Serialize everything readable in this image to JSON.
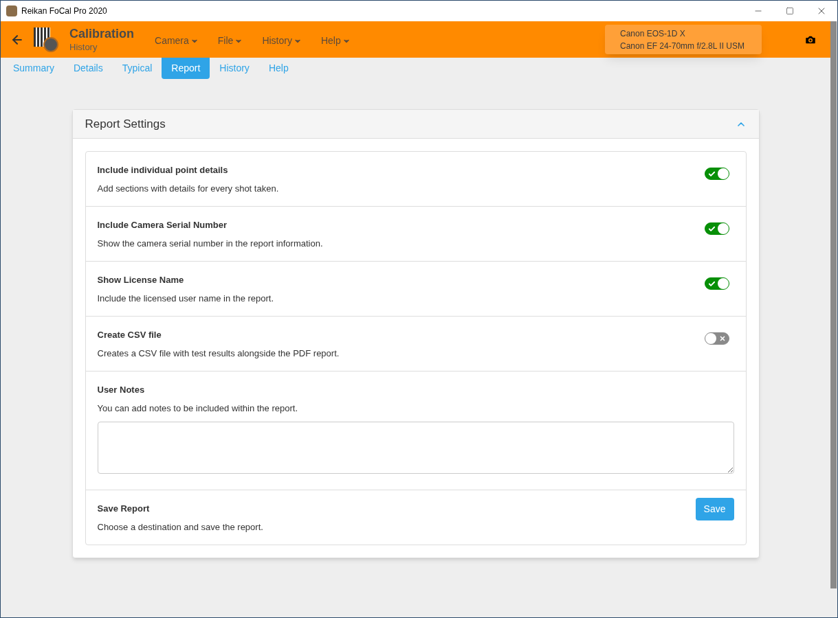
{
  "window": {
    "title": "Reikan FoCal Pro 2020"
  },
  "header": {
    "title": "Calibration",
    "subtitle": "History",
    "menus": [
      {
        "label": "Camera"
      },
      {
        "label": "File"
      },
      {
        "label": "History"
      },
      {
        "label": "Help"
      }
    ],
    "device": {
      "camera": "Canon EOS-1D X",
      "lens": "Canon EF 24-70mm f/2.8L II USM"
    }
  },
  "tabs": [
    {
      "label": "Summary",
      "selected": false
    },
    {
      "label": "Details",
      "selected": false
    },
    {
      "label": "Typical",
      "selected": false
    },
    {
      "label": "Report",
      "selected": true
    },
    {
      "label": "History",
      "selected": false
    },
    {
      "label": "Help",
      "selected": false
    }
  ],
  "panel": {
    "title": "Report Settings",
    "expanded": true,
    "rows": [
      {
        "kind": "toggle",
        "title": "Include individual point details",
        "description": "Add sections with details for every shot taken.",
        "on": true
      },
      {
        "kind": "toggle",
        "title": "Include Camera Serial Number",
        "description": "Show the camera serial number in the report information.",
        "on": true
      },
      {
        "kind": "toggle",
        "title": "Show License Name",
        "description": "Include the licensed user name in the report.",
        "on": true
      },
      {
        "kind": "toggle",
        "title": "Create CSV file",
        "description": "Creates a CSV file with test results alongside the PDF report.",
        "on": false
      },
      {
        "kind": "notes",
        "title": "User Notes",
        "description": "You can add notes to be included within the report."
      },
      {
        "kind": "button",
        "title": "Save Report",
        "description": "Choose a destination and save the report.",
        "button": "Save"
      }
    ]
  }
}
